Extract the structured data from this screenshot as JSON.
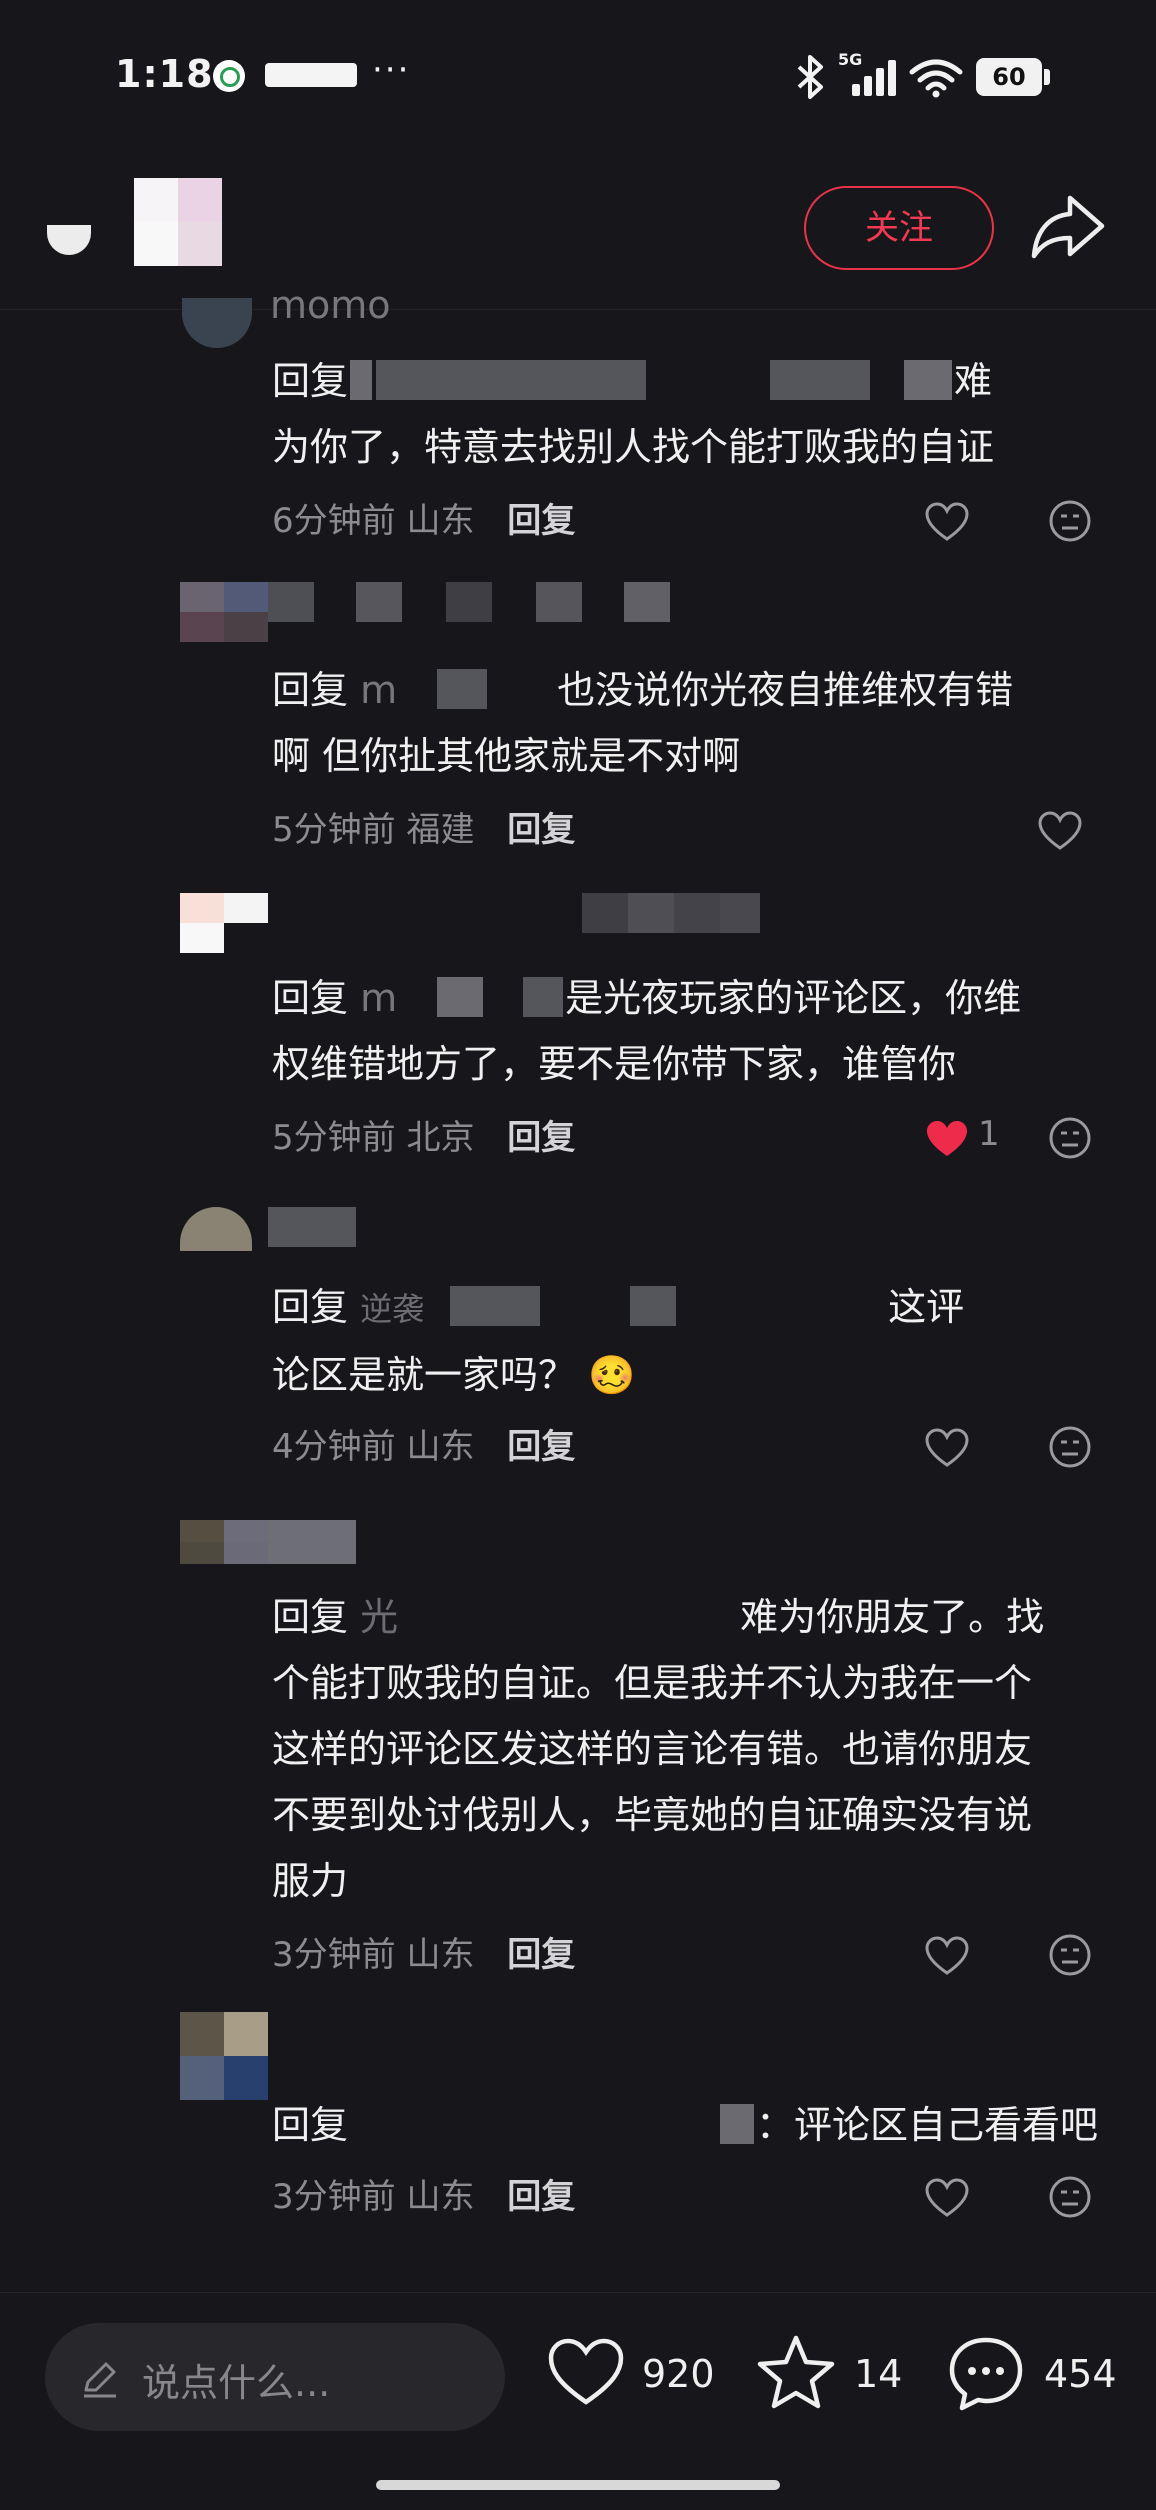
{
  "status_bar": {
    "time": "1:18",
    "network": "5G",
    "battery": "60"
  },
  "header": {
    "follow_label": "关注"
  },
  "comments": [
    {
      "name": "momo",
      "reply_prefix": "回复",
      "line1_tail": "难",
      "line2": "为你了，特意去找别人找个能打败我的自证",
      "time": "6分钟前",
      "location": "山东",
      "reply_label": "回复",
      "likes": ""
    },
    {
      "reply_prefix": "回复",
      "mention": "m",
      "line1_tail": "也没说你光夜自推维权有错",
      "line2": "啊 但你扯其他家就是不对啊",
      "time": "5分钟前",
      "location": "福建",
      "reply_label": "回复",
      "likes": ""
    },
    {
      "reply_prefix": "回复",
      "mention": "m",
      "line1_tail": "是光夜玩家的评论区，你维",
      "line2": "权维错地方了，要不是你带下家，谁管你",
      "time": "5分钟前",
      "location": "北京",
      "reply_label": "回复",
      "likes": "1"
    },
    {
      "reply_prefix": "回复",
      "mention": "逆袭",
      "line1_tail": "这评",
      "line2": "论区是就一家吗？",
      "emoji": "🥴",
      "time": "4分钟前",
      "location": "山东",
      "reply_label": "回复",
      "likes": ""
    },
    {
      "reply_prefix": "回复",
      "mention": "光",
      "line1_tail": "难为你朋友了。找",
      "line2": "个能打败我的自证。但是我并不认为我在一个",
      "line3": "这样的评论区发这样的言论有错。也请你朋友",
      "line4": "不要到处讨伐别人，毕竟她的自证确实没有说",
      "line5": "服力",
      "time": "3分钟前",
      "location": "山东",
      "reply_label": "回复",
      "likes": ""
    },
    {
      "reply_prefix": "回复",
      "line1_tail": "：评论区自己看看吧",
      "time": "3分钟前",
      "location": "山东",
      "reply_label": "回复",
      "likes": ""
    }
  ],
  "bottom_bar": {
    "input_placeholder": "说点什么...",
    "like_count": "920",
    "favorite_count": "14",
    "comment_count": "454"
  },
  "colors": {
    "background": "#17171b",
    "accent_red": "#f23a52",
    "text_primary": "#f0f0f1",
    "text_secondary": "#8b8b90"
  }
}
